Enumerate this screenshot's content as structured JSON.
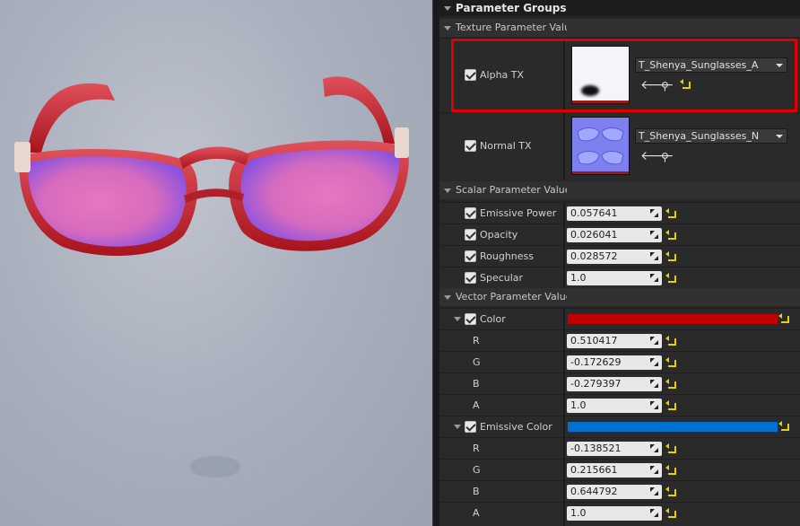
{
  "panel": {
    "title": "Parameter Groups",
    "texture_group": "Texture Parameter Values",
    "texture_params": [
      {
        "label": "Alpha TX",
        "asset": "T_Shenya_Sunglasses_A"
      },
      {
        "label": "Normal TX",
        "asset": "T_Shenya_Sunglasses_N"
      }
    ],
    "scalar_group": "Scalar Parameter Values",
    "scalar_params": [
      {
        "label": "Emissive Power",
        "value": "0.057641"
      },
      {
        "label": "Opacity",
        "value": "0.026041"
      },
      {
        "label": "Roughness",
        "value": "0.028572"
      },
      {
        "label": "Specular",
        "value": "1.0"
      }
    ],
    "vector_group": "Vector Parameter Values",
    "vector_params": [
      {
        "label": "Color",
        "swatch": "#c00000",
        "channels": [
          {
            "name": "R",
            "value": "0.510417"
          },
          {
            "name": "G",
            "value": "-0.172629"
          },
          {
            "name": "B",
            "value": "-0.279397"
          },
          {
            "name": "A",
            "value": "1.0"
          }
        ]
      },
      {
        "label": "Emissive Color",
        "swatch": "#0070d0",
        "channels": [
          {
            "name": "R",
            "value": "-0.138521"
          },
          {
            "name": "G",
            "value": "0.215661"
          },
          {
            "name": "B",
            "value": "0.644792"
          },
          {
            "name": "A",
            "value": "1.0"
          }
        ]
      }
    ]
  },
  "icons": {
    "use_selected": "left-arrow-icon",
    "browse": "magnifier-icon",
    "reset": "reset-to-default-icon"
  },
  "colors": {
    "highlight": "#e00000",
    "frame_red": "#c41e2a",
    "lens_pink": "#e070b8"
  }
}
